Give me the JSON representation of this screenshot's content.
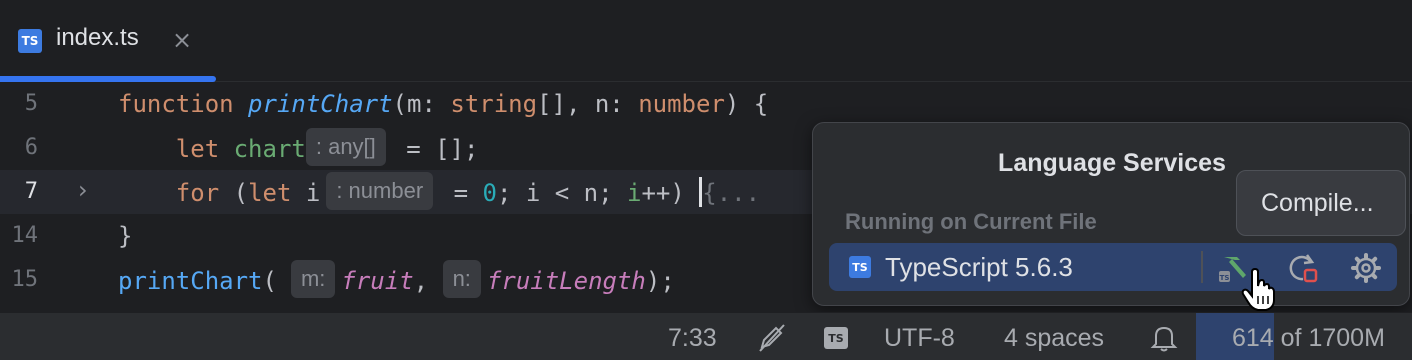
{
  "tab": {
    "title": "index.ts",
    "badge": "TS",
    "close": "×"
  },
  "editor": {
    "lines": [
      {
        "number": "5"
      },
      {
        "number": "6"
      },
      {
        "number": "7",
        "fold": "›"
      },
      {
        "number": "14"
      },
      {
        "number": "15"
      }
    ],
    "code": {
      "l5": {
        "kw": "function",
        "fn": "printChart",
        "p1": "(m: ",
        "t1": "string",
        "p2": "[], n: ",
        "t2": "number",
        "p3": ") {"
      },
      "l6": {
        "kw": "let",
        "var": "chart",
        "hint": ": any[]",
        "rest": " = [];"
      },
      "l7": {
        "kw": "for",
        "open": " (",
        "kw2": "let",
        "i": " i",
        "hint": ": number",
        "eq": " = ",
        "zero": "0",
        "cond": "; i < n; ",
        "inc_var": "i",
        "inc": "++) ",
        "folded": "{..."
      },
      "l14": {
        "text": "}"
      },
      "l15": {
        "fn": "printChart",
        "open": "(",
        "hint1": "m:",
        "arg1": "fruit",
        "comma": ",",
        "hint2": "n:",
        "arg2": "fruitLength",
        "close": ");"
      }
    }
  },
  "popup": {
    "title": "Language Services",
    "section": "Running on Current File",
    "service": {
      "badge": "TS",
      "name": "TypeScript 5.6.3"
    }
  },
  "tooltip": {
    "text": "Compile..."
  },
  "statusbar": {
    "position": "7:33",
    "encoding": "UTF-8",
    "indent": "4 spaces",
    "ts_badge": "TS",
    "memory": {
      "text": "614 of 1700M",
      "used": 614,
      "total": 1700
    }
  },
  "colors": {
    "accent": "#3574f0",
    "selection": "#2e436e",
    "compile_icon": "#5fa66b",
    "restart_badge": "#e0504d"
  }
}
